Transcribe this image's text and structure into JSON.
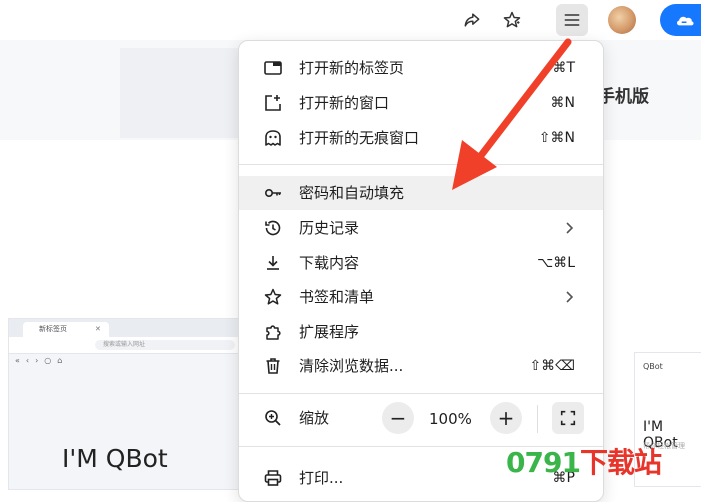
{
  "toolbar": {
    "icons": [
      "share-icon",
      "star-icon",
      "menu-icon"
    ],
    "accent": "#1677ff"
  },
  "page": {
    "phone_label": "手机版",
    "preview_tab_title": "新标签页",
    "preview_address": "搜索或输入网址",
    "hero_title": "I'M QBot",
    "right_logo_text": "QBot",
    "right_title": "I'M QBot",
    "right_sub": "帮你轻松管理"
  },
  "menu": {
    "new_tab": {
      "label": "打开新的标签页",
      "shortcut": "⌘T"
    },
    "new_window": {
      "label": "打开新的窗口",
      "shortcut": "⌘N"
    },
    "incognito": {
      "label": "打开新的无痕窗口",
      "shortcut": "⇧⌘N"
    },
    "passwords": {
      "label": "密码和自动填充"
    },
    "history": {
      "label": "历史记录"
    },
    "downloads": {
      "label": "下载内容",
      "shortcut": "⌥⌘L"
    },
    "bookmarks": {
      "label": "书签和清单"
    },
    "extensions": {
      "label": "扩展程序"
    },
    "clear_data": {
      "label": "清除浏览数据...",
      "shortcut": "⇧⌘⌫"
    },
    "zoom": {
      "label": "缩放",
      "minus": "−",
      "value": "100%",
      "plus": "+"
    },
    "print": {
      "label": "打印...",
      "shortcut": "⌘P"
    },
    "highlighted_item": "passwords",
    "highlight_color": "#f0f0f0"
  },
  "annotation": {
    "arrow_color": "#f0402a"
  },
  "watermark": {
    "text_num": "0791",
    "text_zh": "下载站",
    "color_green": "#39b54a",
    "color_red": "#e8352b"
  }
}
